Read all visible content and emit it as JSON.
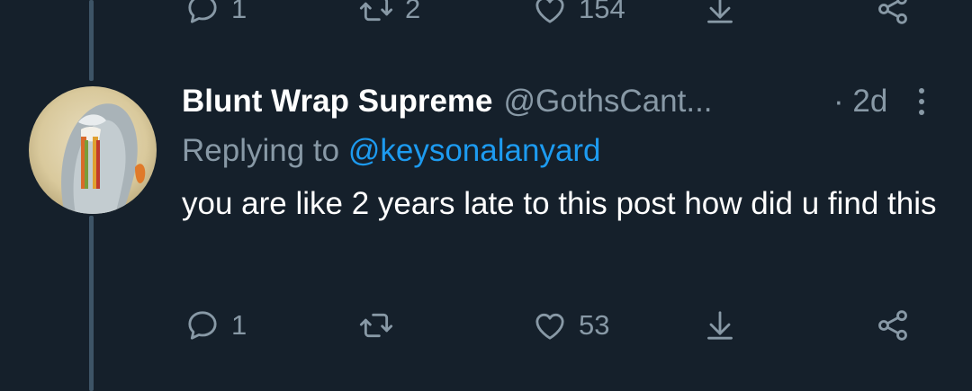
{
  "previous_tweet": {
    "actions": {
      "reply_count": "1",
      "retweet_count": "2",
      "like_count": "154"
    }
  },
  "tweet": {
    "display_name": "Blunt Wrap Supreme",
    "handle": "@GothsCant...",
    "time": "· 2d",
    "replying_to_label": "Replying to",
    "replying_to_handle": "@keysonalanyard",
    "text": "you are like 2 years late to this post how did u find this",
    "actions": {
      "reply_count": "1",
      "retweet_count": "",
      "like_count": "53"
    }
  },
  "colors": {
    "background": "#15202b",
    "muted": "#8899a6",
    "accent": "#1d9bf0",
    "thread_line": "#3d5466"
  },
  "icons": [
    "reply-icon",
    "retweet-icon",
    "like-icon",
    "share-icon",
    "network-share-icon",
    "more-icon"
  ]
}
